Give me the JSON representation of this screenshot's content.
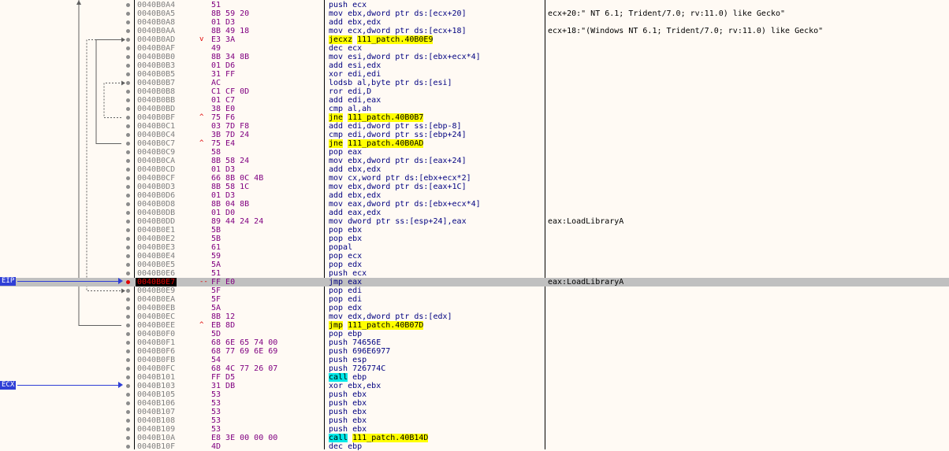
{
  "rows": [
    {
      "addr": "0040B0A4",
      "bytes": "51",
      "dis": [
        [
          "push ecx",
          ""
        ]
      ],
      "comment": "",
      "mark": ""
    },
    {
      "addr": "0040B0A5",
      "bytes": "8B 59 20",
      "dis": [
        [
          "mov ebx,dword ptr ds:[ecx+20]",
          ""
        ]
      ],
      "comment": "ecx+20:\" NT 6.1; Trident/7.0; rv:11.0) like Gecko\"",
      "mark": ""
    },
    {
      "addr": "0040B0A8",
      "bytes": "01 D3",
      "dis": [
        [
          "add ebx,edx",
          ""
        ]
      ],
      "comment": "",
      "mark": ""
    },
    {
      "addr": "0040B0AA",
      "bytes": "8B 49 18",
      "dis": [
        [
          "mov ecx,dword ptr ds:[ecx+18]",
          ""
        ]
      ],
      "comment": "ecx+18:\"(Windows NT 6.1; Trident/7.0; rv:11.0) like Gecko\"",
      "mark": ""
    },
    {
      "addr": "0040B0AD",
      "bytes": "E3 3A",
      "dis": [
        [
          "jecxz",
          "hl"
        ],
        [
          " ",
          ""
        ],
        [
          "111_patch.40B0E9",
          "hl"
        ]
      ],
      "comment": "",
      "mark": "v"
    },
    {
      "addr": "0040B0AF",
      "bytes": "49",
      "dis": [
        [
          "dec ecx",
          ""
        ]
      ],
      "comment": "",
      "mark": ""
    },
    {
      "addr": "0040B0B0",
      "bytes": "8B 34 8B",
      "dis": [
        [
          "mov esi,dword ptr ds:[ebx+ecx*4]",
          ""
        ]
      ],
      "comment": "",
      "mark": ""
    },
    {
      "addr": "0040B0B3",
      "bytes": "01 D6",
      "dis": [
        [
          "add esi,edx",
          ""
        ]
      ],
      "comment": "",
      "mark": ""
    },
    {
      "addr": "0040B0B5",
      "bytes": "31 FF",
      "dis": [
        [
          "xor edi,edi",
          ""
        ]
      ],
      "comment": "",
      "mark": ""
    },
    {
      "addr": "0040B0B7",
      "bytes": "AC",
      "dis": [
        [
          "lodsb al,byte ptr ds:[esi]",
          ""
        ]
      ],
      "comment": "",
      "mark": ""
    },
    {
      "addr": "0040B0B8",
      "bytes": "C1 CF 0D",
      "dis": [
        [
          "ror edi,D",
          ""
        ]
      ],
      "comment": "",
      "mark": ""
    },
    {
      "addr": "0040B0BB",
      "bytes": "01 C7",
      "dis": [
        [
          "add edi,eax",
          ""
        ]
      ],
      "comment": "",
      "mark": ""
    },
    {
      "addr": "0040B0BD",
      "bytes": "38 E0",
      "dis": [
        [
          "cmp al,ah",
          ""
        ]
      ],
      "comment": "",
      "mark": ""
    },
    {
      "addr": "0040B0BF",
      "bytes": "75 F6",
      "dis": [
        [
          "jne",
          "hl"
        ],
        [
          " ",
          ""
        ],
        [
          "111_patch.40B0B7",
          "hl"
        ]
      ],
      "comment": "",
      "mark": "^"
    },
    {
      "addr": "0040B0C1",
      "bytes": "03 7D F8",
      "dis": [
        [
          "add edi,dword ptr ss:[ebp-8]",
          ""
        ]
      ],
      "comment": "",
      "mark": ""
    },
    {
      "addr": "0040B0C4",
      "bytes": "3B 7D 24",
      "dis": [
        [
          "cmp edi,dword ptr ss:[ebp+24]",
          ""
        ]
      ],
      "comment": "",
      "mark": ""
    },
    {
      "addr": "0040B0C7",
      "bytes": "75 E4",
      "dis": [
        [
          "jne",
          "hl"
        ],
        [
          " ",
          ""
        ],
        [
          "111_patch.40B0AD",
          "hl"
        ]
      ],
      "comment": "",
      "mark": "^"
    },
    {
      "addr": "0040B0C9",
      "bytes": "58",
      "dis": [
        [
          "pop eax",
          ""
        ]
      ],
      "comment": "",
      "mark": ""
    },
    {
      "addr": "0040B0CA",
      "bytes": "8B 58 24",
      "dis": [
        [
          "mov ebx,dword ptr ds:[eax+24]",
          ""
        ]
      ],
      "comment": "",
      "mark": ""
    },
    {
      "addr": "0040B0CD",
      "bytes": "01 D3",
      "dis": [
        [
          "add ebx,edx",
          ""
        ]
      ],
      "comment": "",
      "mark": ""
    },
    {
      "addr": "0040B0CF",
      "bytes": "66 8B 0C 4B",
      "dis": [
        [
          "mov cx,word ptr ds:[ebx+ecx*2]",
          ""
        ]
      ],
      "comment": "",
      "mark": ""
    },
    {
      "addr": "0040B0D3",
      "bytes": "8B 58 1C",
      "dis": [
        [
          "mov ebx,dword ptr ds:[eax+1C]",
          ""
        ]
      ],
      "comment": "",
      "mark": ""
    },
    {
      "addr": "0040B0D6",
      "bytes": "01 D3",
      "dis": [
        [
          "add ebx,edx",
          ""
        ]
      ],
      "comment": "",
      "mark": ""
    },
    {
      "addr": "0040B0D8",
      "bytes": "8B 04 8B",
      "dis": [
        [
          "mov eax,dword ptr ds:[ebx+ecx*4]",
          ""
        ]
      ],
      "comment": "",
      "mark": ""
    },
    {
      "addr": "0040B0DB",
      "bytes": "01 D0",
      "dis": [
        [
          "add eax,edx",
          ""
        ]
      ],
      "comment": "",
      "mark": ""
    },
    {
      "addr": "0040B0DD",
      "bytes": "89 44 24 24",
      "dis": [
        [
          "mov dword ptr ss:[esp+24],eax",
          ""
        ]
      ],
      "comment": "eax:LoadLibraryA",
      "mark": ""
    },
    {
      "addr": "0040B0E1",
      "bytes": "5B",
      "dis": [
        [
          "pop ebx",
          ""
        ]
      ],
      "comment": "",
      "mark": ""
    },
    {
      "addr": "0040B0E2",
      "bytes": "5B",
      "dis": [
        [
          "pop ebx",
          ""
        ]
      ],
      "comment": "",
      "mark": ""
    },
    {
      "addr": "0040B0E3",
      "bytes": "61",
      "dis": [
        [
          "popal",
          ""
        ]
      ],
      "comment": "",
      "mark": ""
    },
    {
      "addr": "0040B0E4",
      "bytes": "59",
      "dis": [
        [
          "pop ecx",
          ""
        ]
      ],
      "comment": "",
      "mark": ""
    },
    {
      "addr": "0040B0E5",
      "bytes": "5A",
      "dis": [
        [
          "pop edx",
          ""
        ]
      ],
      "comment": "",
      "mark": ""
    },
    {
      "addr": "0040B0E6",
      "bytes": "51",
      "dis": [
        [
          "push ecx",
          ""
        ]
      ],
      "comment": "",
      "mark": ""
    },
    {
      "addr": "0040B0E7",
      "bytes": "FF E0",
      "dis": [
        [
          "jmp eax",
          ""
        ]
      ],
      "comment": "eax:LoadLibraryA",
      "mark": "--",
      "current": true
    },
    {
      "addr": "0040B0E9",
      "bytes": "5F",
      "dis": [
        [
          "pop edi",
          ""
        ]
      ],
      "comment": "",
      "mark": ""
    },
    {
      "addr": "0040B0EA",
      "bytes": "5F",
      "dis": [
        [
          "pop edi",
          ""
        ]
      ],
      "comment": "",
      "mark": ""
    },
    {
      "addr": "0040B0EB",
      "bytes": "5A",
      "dis": [
        [
          "pop edx",
          ""
        ]
      ],
      "comment": "",
      "mark": ""
    },
    {
      "addr": "0040B0EC",
      "bytes": "8B 12",
      "dis": [
        [
          "mov edx,dword ptr ds:[edx]",
          ""
        ]
      ],
      "comment": "",
      "mark": ""
    },
    {
      "addr": "0040B0EE",
      "bytes": "EB 8D",
      "dis": [
        [
          "jmp",
          "hl"
        ],
        [
          " ",
          ""
        ],
        [
          "111_patch.40B07D",
          "hl"
        ]
      ],
      "comment": "",
      "mark": "^"
    },
    {
      "addr": "0040B0F0",
      "bytes": "5D",
      "dis": [
        [
          "pop ebp",
          ""
        ]
      ],
      "comment": "",
      "mark": ""
    },
    {
      "addr": "0040B0F1",
      "bytes": "68 6E 65 74 00",
      "dis": [
        [
          "push 74656E",
          ""
        ]
      ],
      "comment": "",
      "mark": ""
    },
    {
      "addr": "0040B0F6",
      "bytes": "68 77 69 6E 69",
      "dis": [
        [
          "push 696E6977",
          ""
        ]
      ],
      "comment": "",
      "mark": ""
    },
    {
      "addr": "0040B0FB",
      "bytes": "54",
      "dis": [
        [
          "push esp",
          ""
        ]
      ],
      "comment": "",
      "mark": ""
    },
    {
      "addr": "0040B0FC",
      "bytes": "68 4C 77 26 07",
      "dis": [
        [
          "push 726774C",
          ""
        ]
      ],
      "comment": "",
      "mark": ""
    },
    {
      "addr": "0040B101",
      "bytes": "FF D5",
      "dis": [
        [
          "call",
          "hlc"
        ],
        [
          " ebp",
          ""
        ]
      ],
      "comment": "",
      "mark": ""
    },
    {
      "addr": "0040B103",
      "bytes": "31 DB",
      "dis": [
        [
          "xor ebx,ebx",
          ""
        ]
      ],
      "comment": "",
      "mark": ""
    },
    {
      "addr": "0040B105",
      "bytes": "53",
      "dis": [
        [
          "push ebx",
          ""
        ]
      ],
      "comment": "",
      "mark": ""
    },
    {
      "addr": "0040B106",
      "bytes": "53",
      "dis": [
        [
          "push ebx",
          ""
        ]
      ],
      "comment": "",
      "mark": ""
    },
    {
      "addr": "0040B107",
      "bytes": "53",
      "dis": [
        [
          "push ebx",
          ""
        ]
      ],
      "comment": "",
      "mark": ""
    },
    {
      "addr": "0040B108",
      "bytes": "53",
      "dis": [
        [
          "push ebx",
          ""
        ]
      ],
      "comment": "",
      "mark": ""
    },
    {
      "addr": "0040B109",
      "bytes": "53",
      "dis": [
        [
          "push ebx",
          ""
        ]
      ],
      "comment": "",
      "mark": ""
    },
    {
      "addr": "0040B10A",
      "bytes": "E8 3E 00 00 00",
      "dis": [
        [
          "call",
          "hlc"
        ],
        [
          " ",
          ""
        ],
        [
          "111_patch.40B14D",
          "hl"
        ]
      ],
      "comment": "",
      "mark": ""
    },
    {
      "addr": "0040B10F",
      "bytes": "4D",
      "dis": [
        [
          "dec ebp",
          ""
        ]
      ],
      "comment": "",
      "mark": ""
    }
  ],
  "labels": {
    "eip": "EIP",
    "ecx": "ECX"
  },
  "colors": {
    "background": "#fffaf4",
    "selected": "#c0c0c0",
    "jump_highlight": "#ffff00",
    "call_highlight": "#00e8e8",
    "tag": "#2f3fd6"
  }
}
